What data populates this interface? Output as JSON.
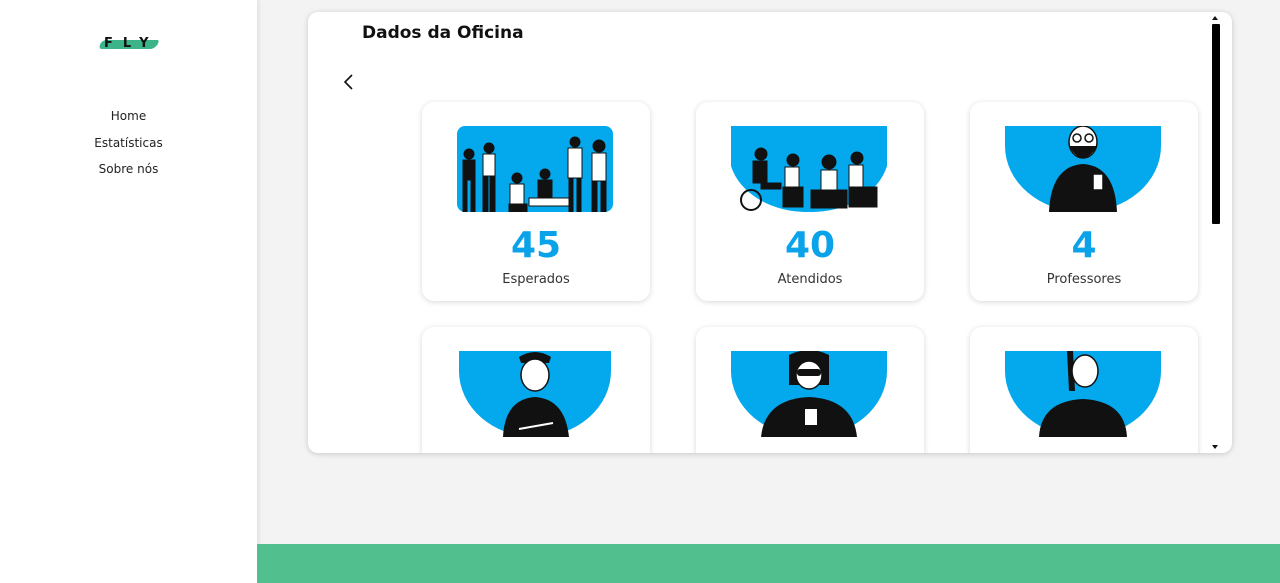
{
  "sidebar": {
    "logo_text": "FLY",
    "nav": [
      {
        "label": "Home"
      },
      {
        "label": "Estatísticas"
      },
      {
        "label": "Sobre nós"
      }
    ]
  },
  "panel": {
    "title": "Dados da Oficina",
    "back_icon": "chevron-left-icon"
  },
  "cards": [
    {
      "value": "45",
      "label": "Esperados",
      "illustration": "group-standing"
    },
    {
      "value": "40",
      "label": "Atendidos",
      "illustration": "group-sitting"
    },
    {
      "value": "4",
      "label": "Professores",
      "illustration": "bearded-man"
    },
    {
      "value": "",
      "label": "",
      "illustration": "woman-headband"
    },
    {
      "value": "",
      "label": "",
      "illustration": "woman-sunglasses"
    },
    {
      "value": "",
      "label": "",
      "illustration": "sad-woman"
    }
  ],
  "colors": {
    "accent": "#0aa2e8",
    "illustration_bg": "#03a9ec",
    "footer": "#52bf8f",
    "logo_swash": "#3bb48a"
  }
}
